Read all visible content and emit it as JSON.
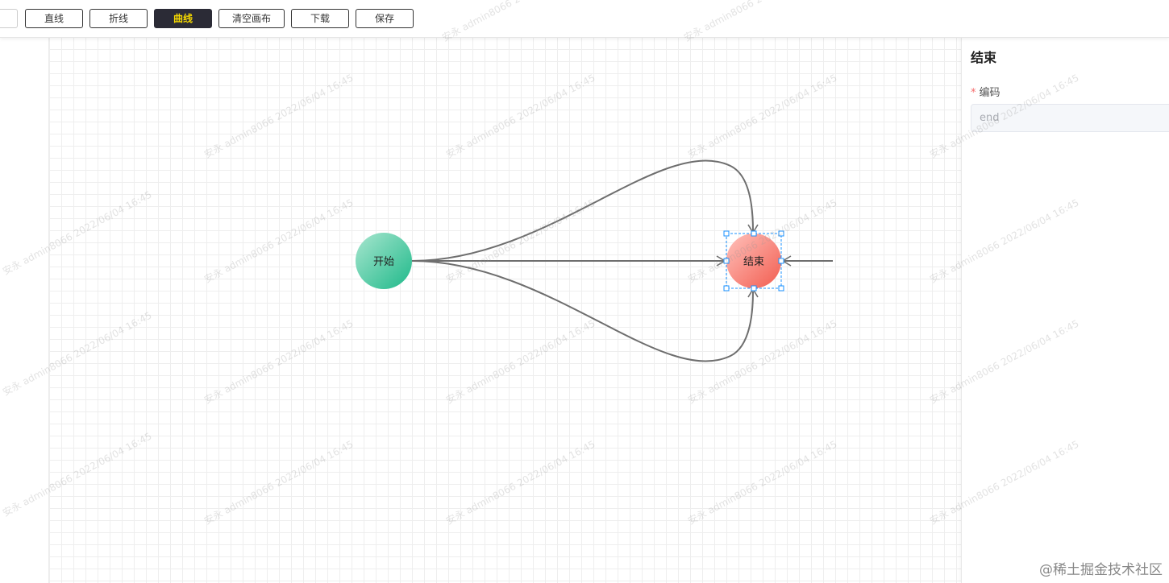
{
  "toolbar": {
    "buttons": [
      {
        "label": "直线"
      },
      {
        "label": "折线"
      },
      {
        "label": "曲线"
      },
      {
        "label": "清空画布"
      },
      {
        "label": "下载"
      },
      {
        "label": "保存"
      }
    ],
    "active_label": "曲线"
  },
  "diagram": {
    "nodes": {
      "start": {
        "label": "开始",
        "color_top": "#a8e6cf",
        "color_bottom": "#1fb98a"
      },
      "end": {
        "label": "结束",
        "color_top": "#ffc2bc",
        "color_bottom": "#f25c4f"
      }
    },
    "edge_color": "#6e6e6e",
    "selection_color": "#1890ff"
  },
  "panel": {
    "title": "结束",
    "field": {
      "label": "编码",
      "required_mark": "*",
      "value": "end"
    }
  },
  "watermark": "安永 admin8066 2022/06/04 16:45",
  "credit": "@稀土掘金技术社区"
}
